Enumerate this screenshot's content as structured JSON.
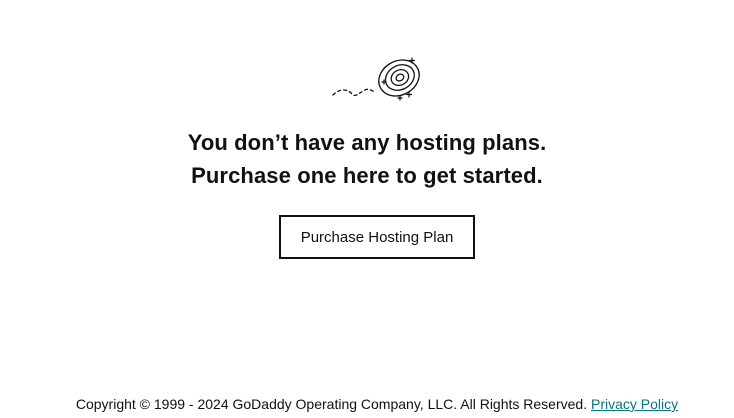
{
  "empty_state": {
    "illustration": "spiral-hole-icon",
    "line1": "You don’t have any hosting plans.",
    "line2": "Purchase one here to get started.",
    "cta_label": "Purchase Hosting Plan"
  },
  "footer": {
    "copyright": "Copyright © 1999 - 2024 GoDaddy Operating Company, LLC. All Rights Reserved.",
    "privacy_link": "Privacy Policy"
  },
  "colors": {
    "text": "#111111",
    "link": "#09757a",
    "background": "#ffffff"
  }
}
